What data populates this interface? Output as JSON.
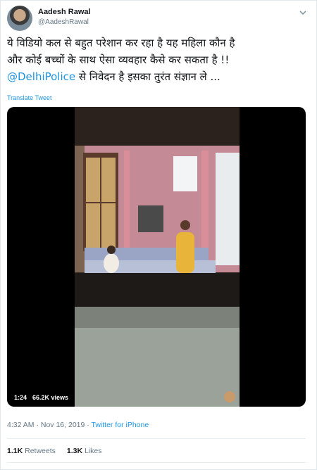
{
  "author": {
    "display_name": "Aadesh Rawal",
    "handle": "@AadeshRawal"
  },
  "tweet": {
    "line1": "ये विडियो कल से बहुत परेशान कर रहा है यह महिला कौन है",
    "line2": "और कोई बच्चों के साथ ऐसा व्यवहार कैसे कर सकता है !!",
    "mention": "@DelhiPolice",
    "line3_rest": " से निवेदन है इसका तुरंत संज्ञान ले ..."
  },
  "translate_label": "Translate Tweet",
  "video": {
    "duration": "1:24",
    "views": "66.2K views"
  },
  "meta": {
    "time": "4:32 AM",
    "separator": " · ",
    "date": "Nov 16, 2019",
    "source": "Twitter for iPhone"
  },
  "stats": {
    "retweets_count": "1.1K",
    "retweets_label": "Retweets",
    "likes_count": "1.3K",
    "likes_label": "Likes"
  },
  "icons": {
    "menu": "chevron-down-icon"
  },
  "colors": {
    "link": "#1b95e0",
    "muted": "#657786",
    "text": "#14171a"
  }
}
